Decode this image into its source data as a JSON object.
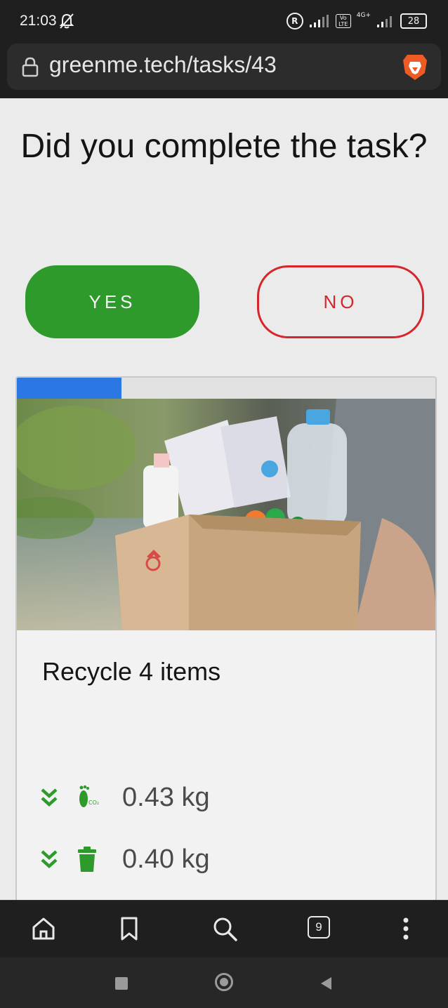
{
  "status": {
    "time": "21:03",
    "sim_badge": "R",
    "volte": "Vo LTE",
    "network": "4G+",
    "battery": "28"
  },
  "browser": {
    "url": "greenme.tech/tasks/43",
    "tab_count": "9"
  },
  "page": {
    "question": "Did you complete the task?",
    "yes_label": "YES",
    "no_label": "NO",
    "task_title": "Recycle 4 items",
    "progress": 0.25,
    "metrics": [
      {
        "icon": "co2-footprint-icon",
        "value": "0.43 kg"
      },
      {
        "icon": "trash-icon",
        "value": "0.40 kg"
      }
    ]
  },
  "colors": {
    "accent_green": "#2e9a2c",
    "no_red": "#d6262b",
    "progress_blue": "#2b78e4"
  }
}
